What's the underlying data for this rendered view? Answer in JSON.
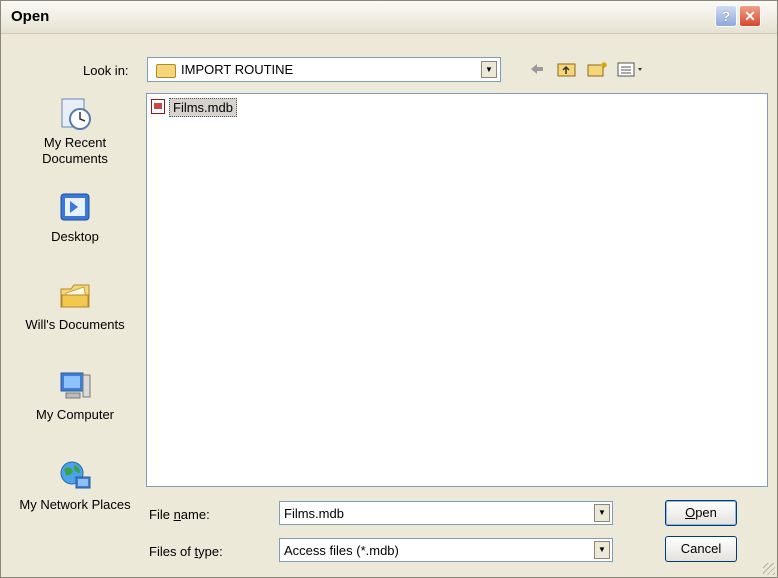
{
  "window": {
    "title": "Open"
  },
  "titlebar": {
    "help_glyph": "?",
    "close_glyph": "✕"
  },
  "lookin": {
    "label": "Look in:",
    "value": "IMPORT ROUTINE"
  },
  "toolbar": {
    "back_icon": "back-arrow-icon",
    "up_icon": "folder-up-icon",
    "new_icon": "new-folder-icon",
    "views_icon": "views-menu-icon"
  },
  "places": [
    {
      "label": "My Recent Documents",
      "icon": "recent-documents-icon"
    },
    {
      "label": "Desktop",
      "icon": "desktop-icon"
    },
    {
      "label": "Will's Documents",
      "icon": "documents-folder-icon"
    },
    {
      "label": "My Computer",
      "icon": "computer-icon"
    },
    {
      "label": "My Network Places",
      "icon": "network-icon"
    }
  ],
  "files": [
    {
      "name": "Films.mdb",
      "icon": "access-database-icon"
    }
  ],
  "filename": {
    "label_pre": "File ",
    "label_u": "n",
    "label_post": "ame:",
    "value": "Films.mdb"
  },
  "filetype": {
    "label_pre": "Files of ",
    "label_u": "t",
    "label_post": "ype:",
    "value": "Access files (*.mdb)"
  },
  "buttons": {
    "open_u": "O",
    "open_rest": "pen",
    "cancel": "Cancel"
  },
  "colors": {
    "title_bg": "#f3f1e8",
    "dialog_bg": "#ece9d8",
    "close_red": "#d8482a",
    "border_blue": "#7f9db9"
  }
}
